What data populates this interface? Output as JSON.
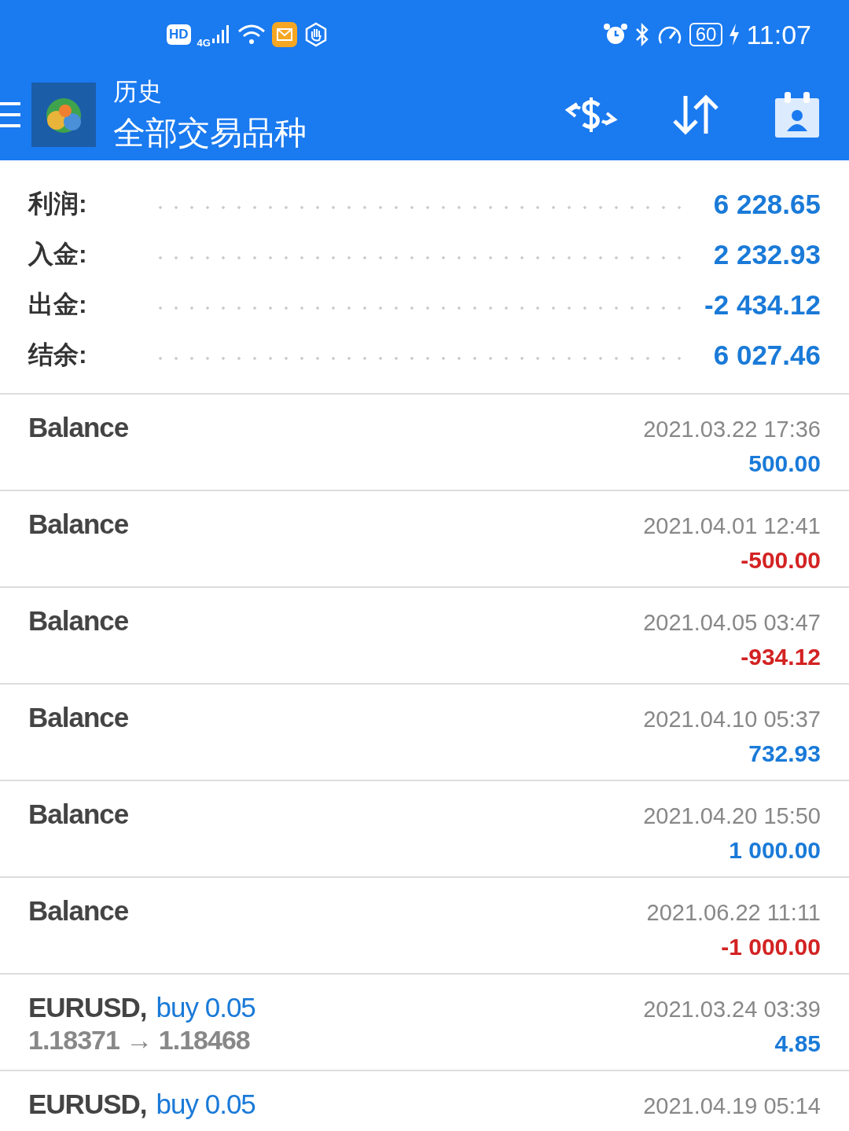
{
  "status_bar": {
    "hd": "HD",
    "network": "4G",
    "battery": "60",
    "time": "11:07"
  },
  "header": {
    "title": "历史",
    "subtitle": "全部交易品种"
  },
  "summary": [
    {
      "label": "利润:",
      "value": "6 228.65"
    },
    {
      "label": "入金:",
      "value": "2 232.93"
    },
    {
      "label": "出金:",
      "value": "-2 434.12"
    },
    {
      "label": "结余:",
      "value": "6 027.46"
    }
  ],
  "deals": [
    {
      "kind": "balance",
      "title": "Balance",
      "time": "2021.03.22 17:36",
      "amount": "500.00",
      "color": "#1a7ad8"
    },
    {
      "kind": "balance",
      "title": "Balance",
      "time": "2021.04.01 12:41",
      "amount": "-500.00",
      "color": "#d32222"
    },
    {
      "kind": "balance",
      "title": "Balance",
      "time": "2021.04.05 03:47",
      "amount": "-934.12",
      "color": "#d32222"
    },
    {
      "kind": "balance",
      "title": "Balance",
      "time": "2021.04.10 05:37",
      "amount": "732.93",
      "color": "#1a7ad8"
    },
    {
      "kind": "balance",
      "title": "Balance",
      "time": "2021.04.20 15:50",
      "amount": "1 000.00",
      "color": "#1a7ad8"
    },
    {
      "kind": "balance",
      "title": "Balance",
      "time": "2021.06.22 11:11",
      "amount": "-1 000.00",
      "color": "#d32222"
    },
    {
      "kind": "trade",
      "title": "EURUSD,",
      "side": "buy 0.05",
      "prices": "1.18371 → 1.18468",
      "time": "2021.03.24 03:39",
      "amount": "4.85",
      "color": "#1a7ad8"
    },
    {
      "kind": "trade",
      "title": "EURUSD,",
      "side": "buy 0.05",
      "time": "2021.04.19 05:14"
    }
  ]
}
